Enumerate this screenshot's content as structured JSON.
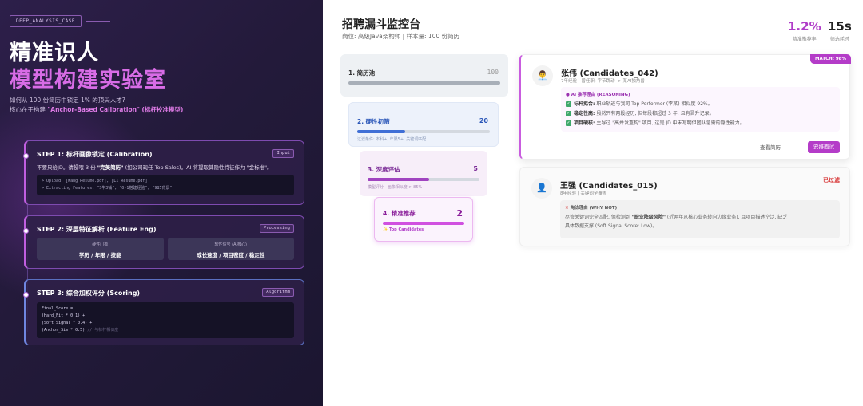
{
  "left": {
    "tag": "DEEP_ANALYSIS_CASE",
    "title_line1": "精准识人",
    "title_line2": "模型构建实验室",
    "subtitle1": "如何从 100 份简历中锁定 1% 的顶尖人才?",
    "subtitle2_prefix": "核心在于构建 ",
    "subtitle2_highlight": "\"Anchor-Based Calibration\" (标杆校准模型)",
    "steps": [
      {
        "title": "STEP 1: 标杆画像锁定 (Calibration)",
        "badge": "Input",
        "desc_prefix": "不要只给JD。请投喂 3 份 ",
        "desc_bold": "\"完美简历\"",
        "desc_suffix": " (如公司现任 Top Sales)。AI 将提取其隐性特征作为 \"金标准\"。",
        "code1": "> Upload: [Wang_Resume.pdf], [Li_Resume.pdf]",
        "code2": "> Extracting Features: \"S牛3铺\", \"0-1搭建经验\", \"985背景\""
      },
      {
        "title": "STEP 2: 深层特征解析 (Feature Eng)",
        "badge": "Processing",
        "box1_label": "硬性门槛",
        "box1_value": "学历 / 年限 / 技能",
        "box2_label": "软性信号 (AI核心)",
        "box2_value": "成长速度 / 项目密度 / 稳定性"
      },
      {
        "title": "STEP 3: 综合加权评分 (Scoring)",
        "badge": "Algorithm",
        "code1": "Final_Score =",
        "code2": "(Hard_Fit * 0.1) +",
        "code3": "(Soft_Signal * 0.4) +",
        "code4": "(Anchor_Sim * 0.5)",
        "code4_comment": " // 与标杆相似度"
      }
    ]
  },
  "right": {
    "title": "招聘漏斗监控台",
    "subtitle": "岗位: 高级Java架构师 | 样本量: 100 份简历",
    "metrics": [
      {
        "value": "1.2%",
        "label": "精准推荐率",
        "color": "#b03cc8"
      },
      {
        "value": "15s",
        "label": "筛选耗时"
      }
    ],
    "funnel": [
      {
        "label": "1. 简历池",
        "value": "100",
        "progress": 1.0
      },
      {
        "label": "2. 硬性初筛",
        "value": "20",
        "progress": 0.36,
        "note": "过滤条件: 本科+, 年限5+, 关键词匹配"
      },
      {
        "label": "3. 深度评估",
        "value": "5",
        "progress": 0.55,
        "note": "模型评分 · 画像相似度 > 85%"
      },
      {
        "label": "4. 精准推荐",
        "value": "2",
        "progress": 1.0,
        "note": "✨ Top Candidates"
      }
    ],
    "candidates": [
      {
        "name": "张伟 (Candidates_042)",
        "meta": "7年经验 | 曾任职: 字节跳动 -> 某AI独角兽",
        "match": "MATCH: 98%",
        "reason_head": "AI 推荐理由 (REASONING)",
        "reasons": [
          {
            "k": "标杆拟合:",
            "v": "职业轨迹与我司 Top Performer (李某) 相似度 92%。"
          },
          {
            "k": "稳定性高:",
            "v": "虽然只有两段经历, 但每段都超过 3 年, 且有晋升记录。"
          },
          {
            "k": "项目硬核:",
            "v": "主导过 \"高并发重构\" 项目, 这是 JD 中未写明但团队急需的隐性能力。"
          }
        ],
        "view": "查看简历",
        "arrange": "安排面试"
      },
      {
        "name": "王强 (Candidates_015)",
        "meta": "8年经验 | 关键词全覆盖",
        "status": "已过滤",
        "why_head": "淘汰理由 (WHY NOT)",
        "why_line1_prefix": "尽管关键词完全匹配, 但检测到 ",
        "why_line1_bold": "\"职业降级风险\"",
        "why_line1_suffix": " (近两年从核心业务转向边缘业务), 且项目描述空泛, 缺乏",
        "why_line2": "具体数据支撑 (Soft Signal Score: Low)。"
      }
    ]
  }
}
